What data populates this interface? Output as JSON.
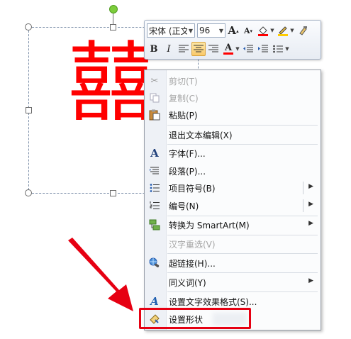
{
  "slide": {
    "big_text": "囍",
    "accent": "#ff0000"
  },
  "mini_toolbar": {
    "font_name": "宋体 (正文",
    "font_size": "96",
    "bold": "B",
    "italic": "I",
    "font_color_glyph": "A",
    "grow_font_glyph": "A",
    "shrink_font_glyph": "A"
  },
  "context_menu": {
    "items": [
      {
        "label": "剪切(T)",
        "icon": "scissors-icon",
        "enabled": false
      },
      {
        "label": "复制(C)",
        "icon": "copy-icon",
        "enabled": false
      },
      {
        "label": "粘贴(P)",
        "icon": "paste-icon",
        "enabled": true
      },
      {
        "label": "退出文本编辑(X)",
        "icon": "",
        "enabled": true
      },
      {
        "label": "字体(F)...",
        "icon": "font-icon",
        "enabled": true
      },
      {
        "label": "段落(P)...",
        "icon": "paragraph-icon",
        "enabled": true
      },
      {
        "label": "项目符号(B)",
        "icon": "bullets-icon",
        "enabled": true,
        "submenu": true
      },
      {
        "label": "编号(N)",
        "icon": "numbering-icon",
        "enabled": true,
        "submenu": true
      },
      {
        "label": "转换为 SmartArt(M)",
        "icon": "smartart-icon",
        "enabled": true,
        "submenu": true
      },
      {
        "label": "汉字重选(V)",
        "icon": "",
        "enabled": false
      },
      {
        "label": "超链接(H)...",
        "icon": "hyperlink-icon",
        "enabled": true
      },
      {
        "label": "同义词(Y)",
        "icon": "",
        "enabled": true,
        "submenu": true
      },
      {
        "label": "设置文字效果格式(S)...",
        "icon": "text-effects-icon",
        "enabled": true
      },
      {
        "label": "设置形状",
        "icon": "format-shape-icon",
        "enabled": true
      }
    ],
    "submenu_arrow": "▶"
  },
  "annotation": {
    "color": "#e60012"
  }
}
